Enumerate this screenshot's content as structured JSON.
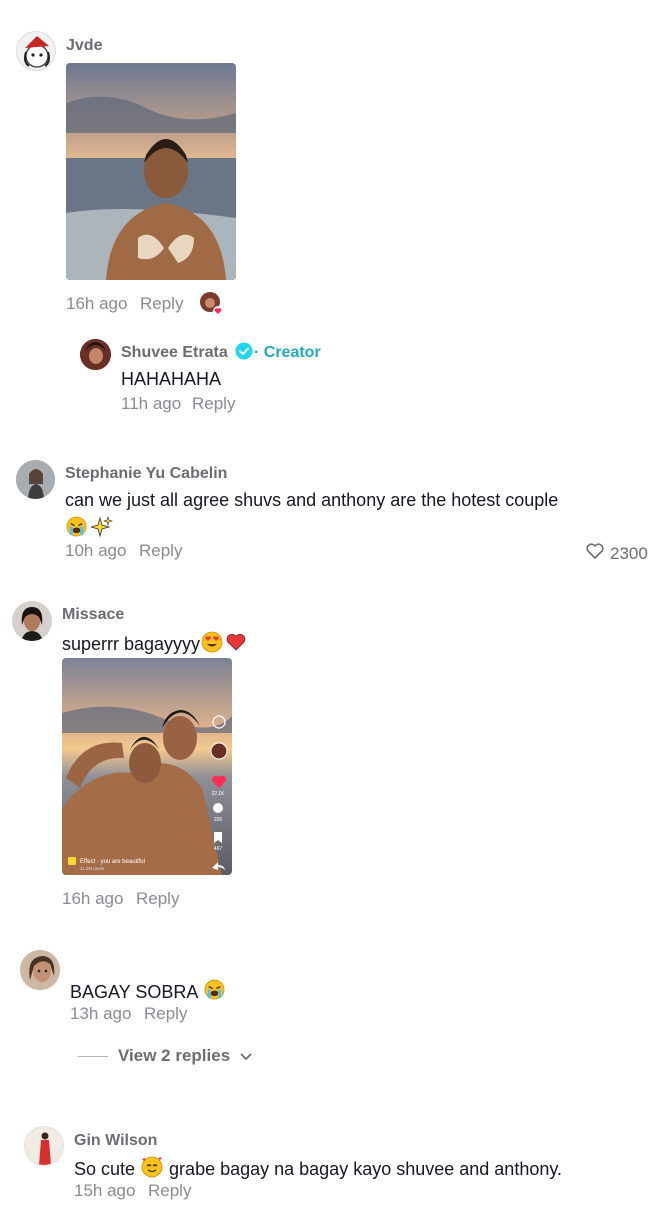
{
  "comments": [
    {
      "username": "Jvde",
      "time": "16h ago",
      "reply_label": "Reply"
    },
    {
      "username": "Shuvee Etrata",
      "creator_badge": "· Creator",
      "text": "HAHAHAHA",
      "time": "11h ago",
      "reply_label": "Reply"
    },
    {
      "username": "Stephanie Yu Cabelin",
      "text": "can we just all agree shuvs and anthony are the hotest couple",
      "time": "10h ago",
      "reply_label": "Reply",
      "likes": "2300"
    },
    {
      "username": "Missace",
      "text": "superrr bagayyyy",
      "time": "16h ago",
      "reply_label": "Reply",
      "embedded": {
        "effect_label": "Effect · you are beautiful",
        "effect_posts": "11.2M posts",
        "like_count": "22.1K",
        "comment_count": "206",
        "save_count": "467"
      }
    },
    {
      "username": "",
      "text": "BAGAY SOBRA",
      "time": "13h ago",
      "reply_label": "Reply",
      "view_replies": "View 2 replies"
    },
    {
      "username": "Gin Wilson",
      "text_before": "So cute",
      "text_after": "grabe bagay na bagay kayo shuvee and anthony.",
      "time": "15h ago",
      "reply_label": "Reply"
    }
  ],
  "colors": {
    "creator": "#20a9c4",
    "muted": "#8a8b91",
    "text": "#161823"
  }
}
